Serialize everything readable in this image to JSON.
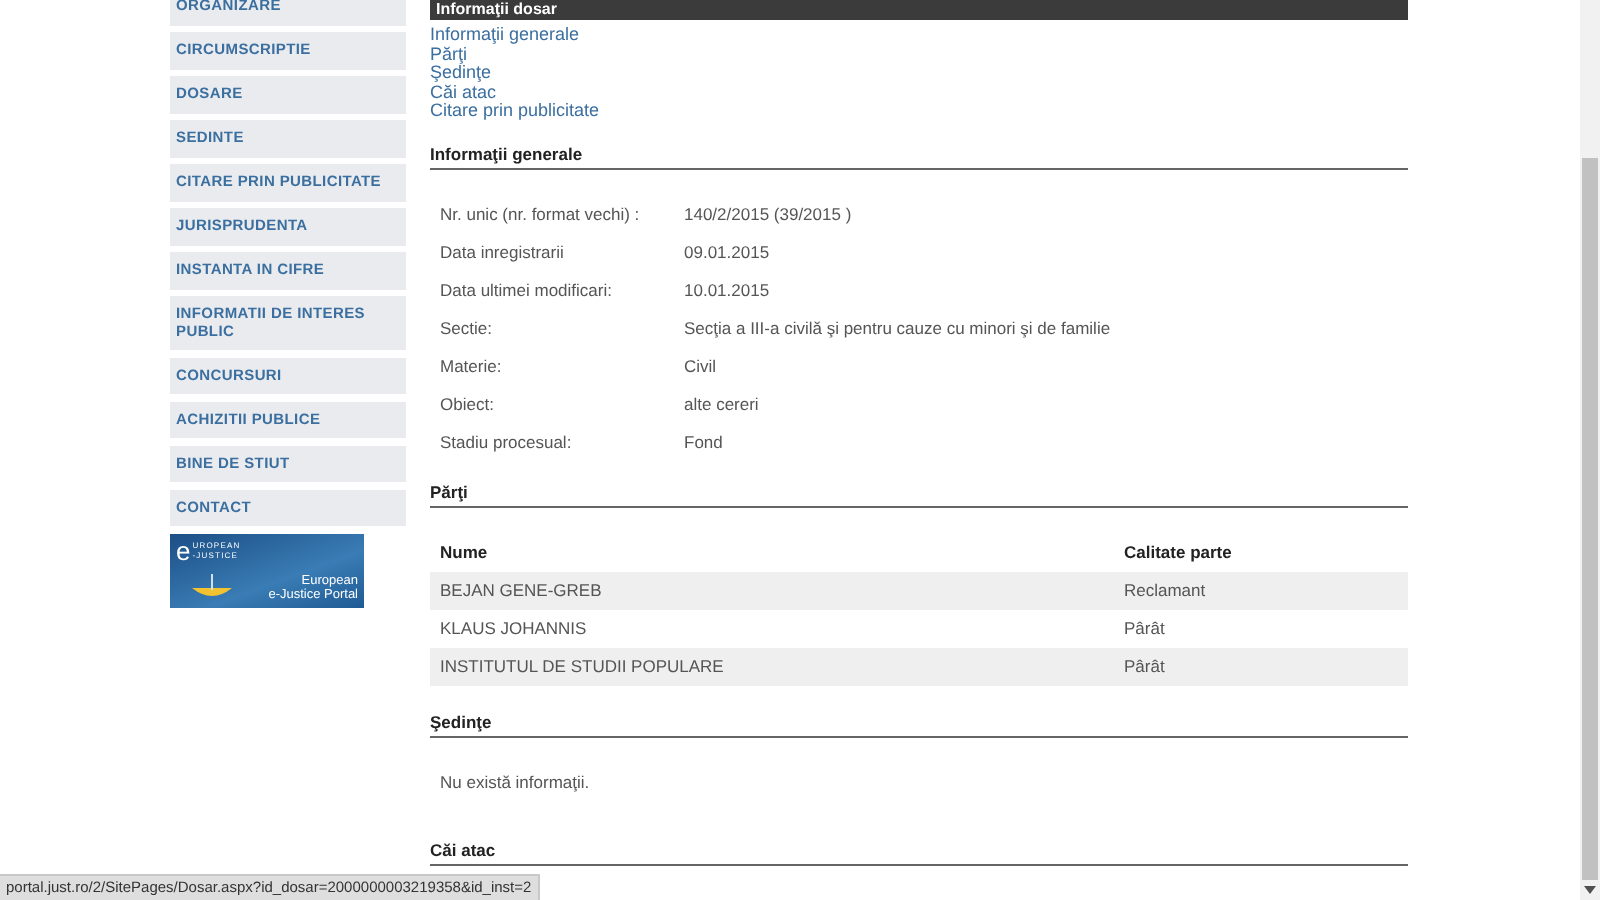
{
  "header": {
    "title": "Informaţii dosar"
  },
  "sidebar": {
    "items": [
      "ORGANIZARE",
      "CIRCUMSCRIPTIE",
      "DOSARE",
      "SEDINTE",
      "CITARE PRIN PUBLICITATE",
      "JURISPRUDENTA",
      "INSTANTA IN CIFRE",
      "INFORMATII DE INTERES PUBLIC",
      "CONCURSURI",
      "ACHIZITII PUBLICE",
      "BINE DE STIUT",
      "CONTACT"
    ],
    "banner": {
      "logo_mark": "e",
      "logo_lines": [
        "UROPEAN",
        "-JUSTICE"
      ],
      "caption_lines": [
        "European",
        "e-Justice Portal"
      ]
    }
  },
  "anchors": [
    "Informaţii generale",
    "Părţi",
    "Şedinţe",
    "Căi atac",
    "Citare prin publicitate"
  ],
  "general": {
    "title": "Informaţii generale",
    "fields": [
      {
        "label": "Nr. unic (nr. format vechi) :",
        "value": "140/2/2015 (39/2015 )"
      },
      {
        "label": "Data inregistrarii",
        "value": "09.01.2015"
      },
      {
        "label": "Data ultimei modificari:",
        "value": "10.01.2015"
      },
      {
        "label": "Sectie:",
        "value": "Secţia a III-a civilă şi pentru cauze cu minori şi de familie"
      },
      {
        "label": "Materie:",
        "value": "Civil"
      },
      {
        "label": "Obiect:",
        "value": "alte cereri"
      },
      {
        "label": "Stadiu procesual:",
        "value": "Fond"
      }
    ]
  },
  "parties": {
    "title": "Părţi",
    "columns": [
      "Nume",
      "Calitate parte"
    ],
    "rows": [
      [
        "BEJAN GENE-GREB",
        "Reclamant"
      ],
      [
        "KLAUS JOHANNIS",
        "Pârât"
      ],
      [
        "INSTITUTUL DE STUDII POPULARE",
        "Pârât"
      ]
    ]
  },
  "hearings": {
    "title": "Şedinţe",
    "message": "Nu există informaţii."
  },
  "appeals": {
    "title": "Căi atac"
  },
  "status_bar": {
    "url": "portal.just.ro/2/SitePages/Dosar.aspx?id_dosar=2000000003219358&id_inst=2"
  }
}
